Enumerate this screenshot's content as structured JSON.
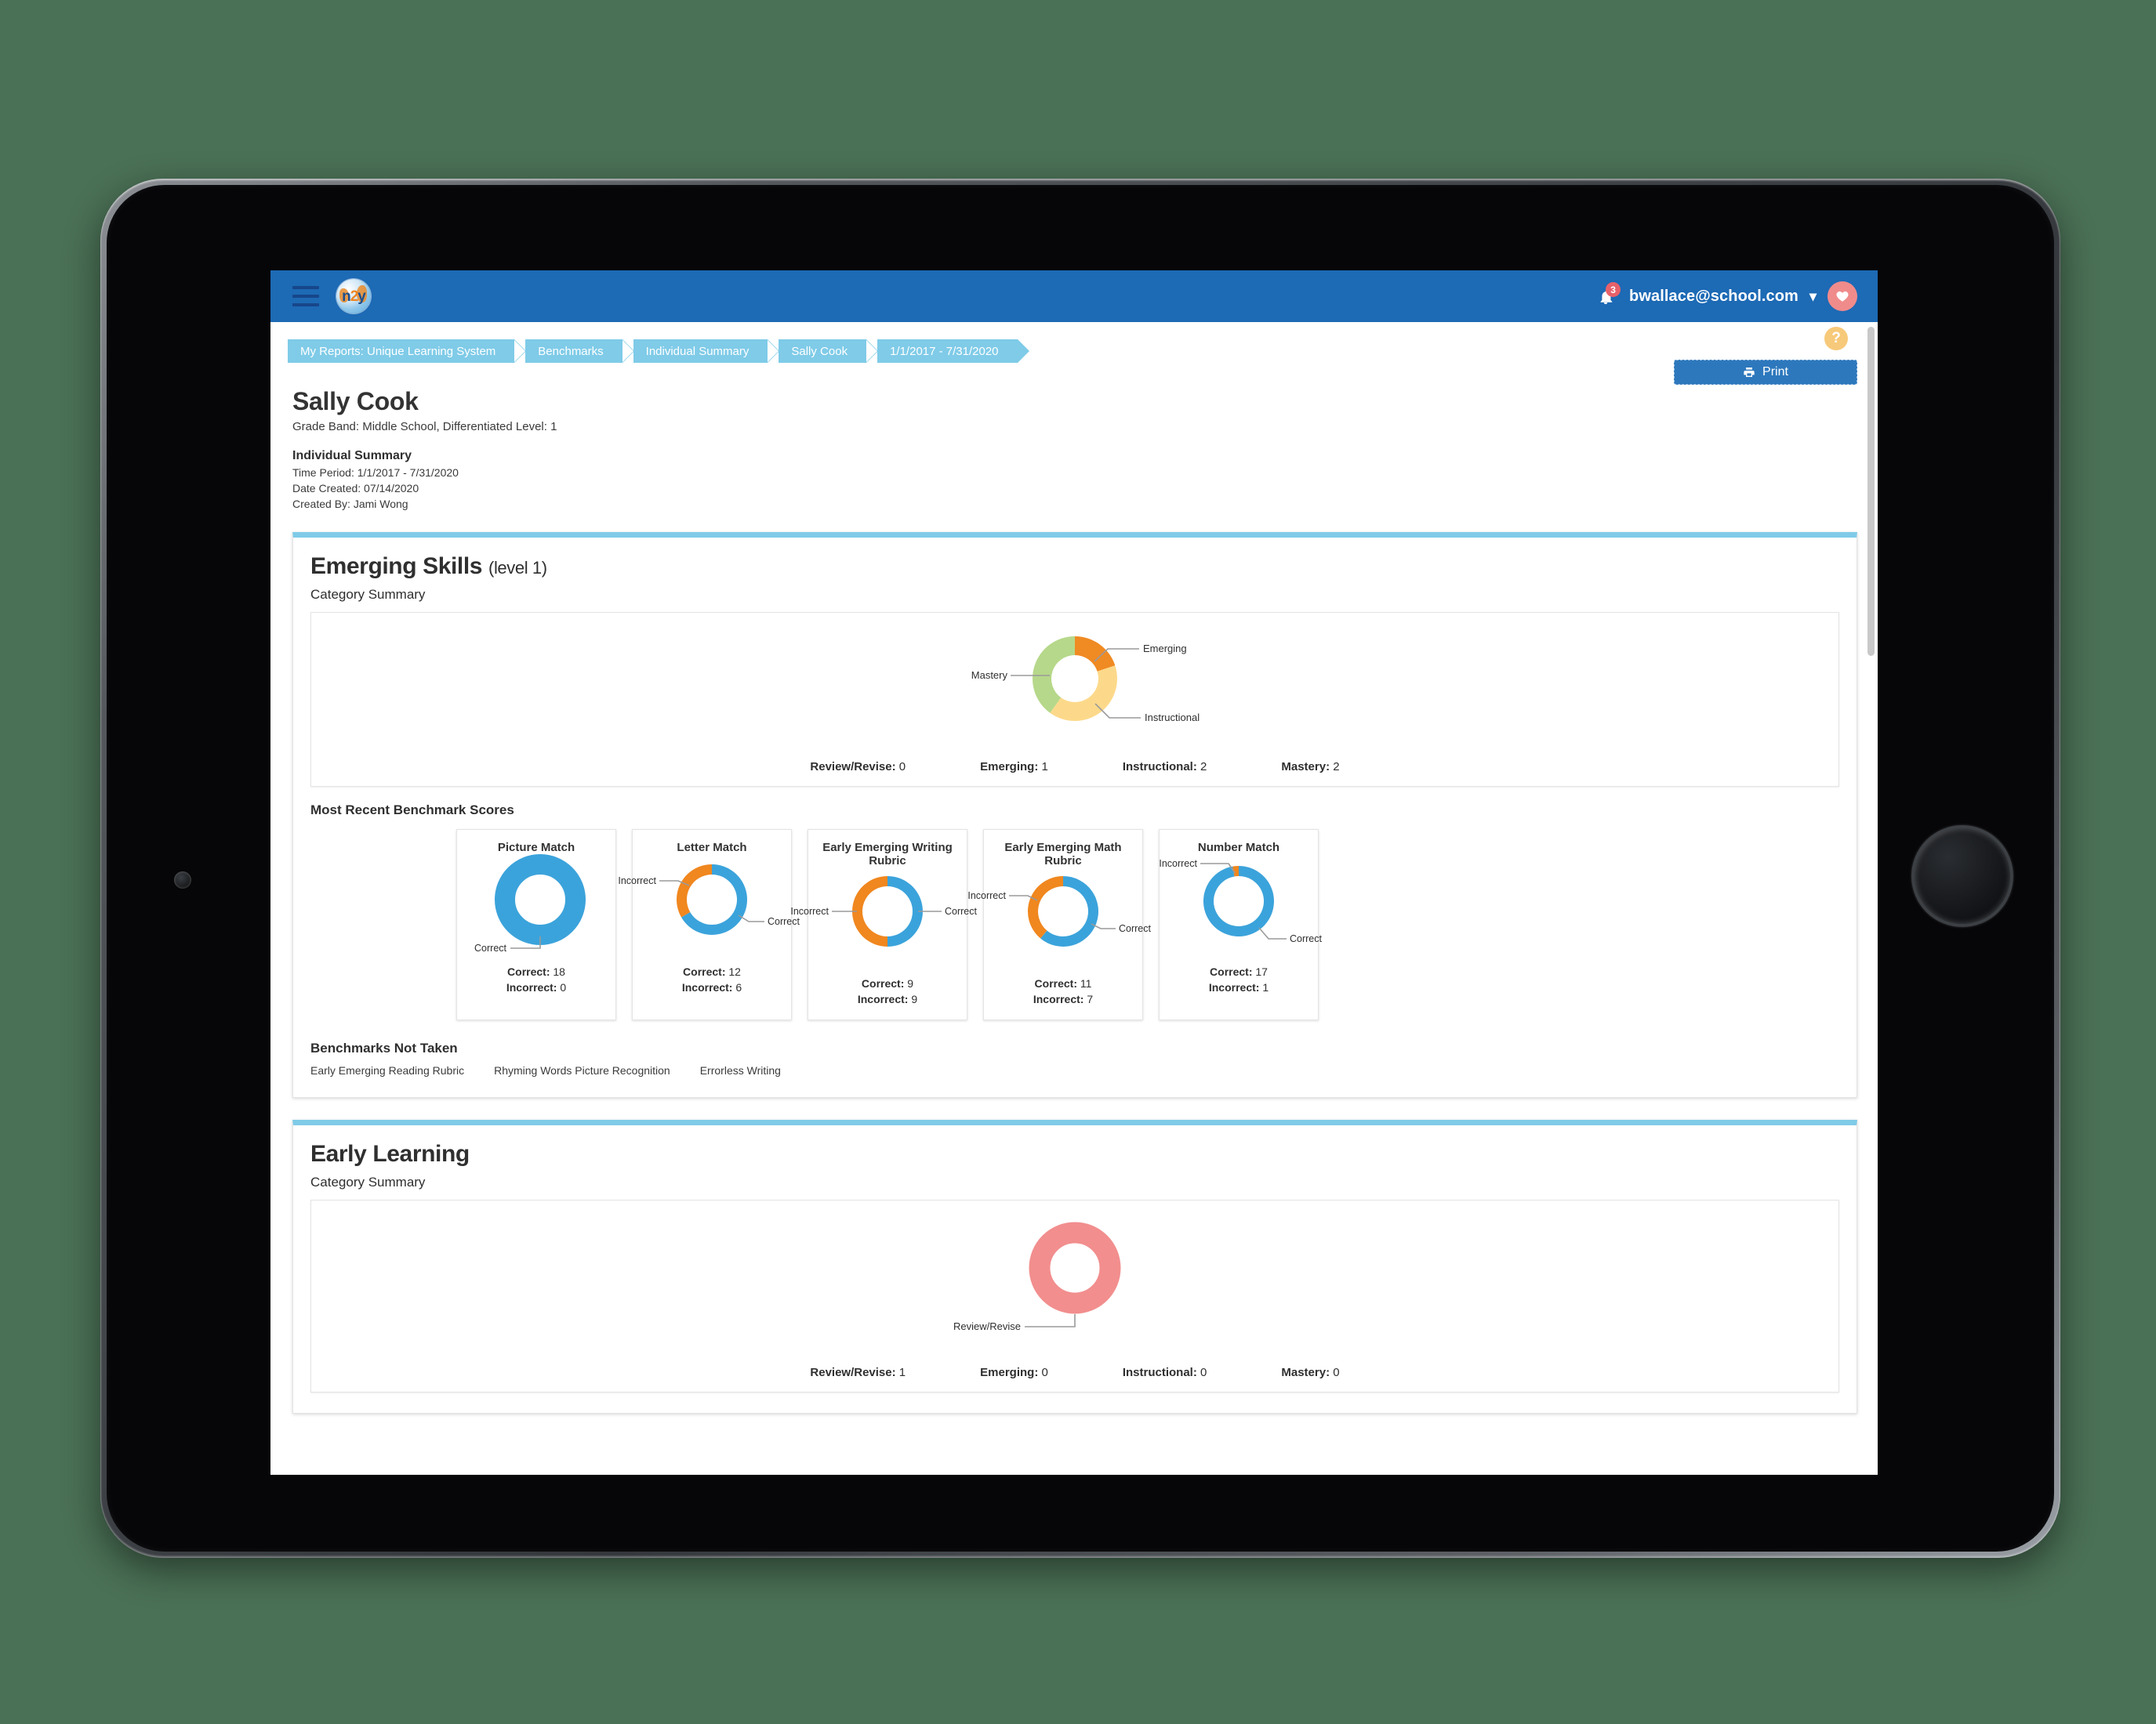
{
  "app": {
    "logo_text_left": "n",
    "logo_text_mid": "2",
    "logo_text_right": "y",
    "user_email": "bwallace@school.com",
    "notification_count": "3",
    "menu_icon": "hamburger-icon",
    "caret": "▾",
    "bell_glyph": "🔔",
    "avatar_glyph": "♥"
  },
  "breadcrumb": {
    "items": [
      "My Reports: Unique Learning System",
      "Benchmarks",
      "Individual Summary",
      "Sally Cook",
      "1/1/2017 - 7/31/2020"
    ]
  },
  "toolbar": {
    "help_label": "?",
    "print_label": "Print",
    "print_icon": "⎙"
  },
  "student": {
    "name": "Sally Cook",
    "grade_line": "Grade Band: Middle School, Differentiated Level: 1",
    "report_type": "Individual Summary",
    "time_period": "Time Period: 1/1/2017 - 7/31/2020",
    "date_created": "Date Created: 07/14/2020",
    "created_by": "Created By: Jami Wong"
  },
  "colors": {
    "brand_blue": "#1d6ab5",
    "accent_light_blue": "#7fcbe8",
    "correct_blue": "#3ba3db",
    "incorrect_orange": "#f0871f",
    "review_revise": "#f28e8e",
    "emerging": "#f08a23",
    "instructional": "#fcd98a",
    "mastery": "#b6d88a"
  },
  "sections": [
    {
      "title": "Emerging Skills",
      "title_suffix": "(level 1)",
      "summary_label": "Category Summary",
      "scores_label": "Most Recent Benchmark Scores",
      "not_taken_label": "Benchmarks Not Taken",
      "not_taken": [
        "Early Emerging Reading Rubric",
        "Rhyming Words Picture Recognition",
        "Errorless Writing"
      ],
      "legend": [
        {
          "label": "Review/Revise:",
          "value": "0"
        },
        {
          "label": "Emerging:",
          "value": "1"
        },
        {
          "label": "Instructional:",
          "value": "2"
        },
        {
          "label": "Mastery:",
          "value": "2"
        }
      ]
    },
    {
      "title": "Early Learning",
      "title_suffix": "",
      "summary_label": "Category Summary",
      "legend": [
        {
          "label": "Review/Revise:",
          "value": "1"
        },
        {
          "label": "Emerging:",
          "value": "0"
        },
        {
          "label": "Instructional:",
          "value": "0"
        },
        {
          "label": "Mastery:",
          "value": "0"
        }
      ]
    }
  ],
  "labels": {
    "correct": "Correct",
    "incorrect": "Incorrect",
    "correct_prefix": "Correct:",
    "incorrect_prefix": "Incorrect:",
    "emerging": "Emerging",
    "instructional": "Instructional",
    "mastery": "Mastery",
    "review_revise": "Review/Revise"
  },
  "chart_data": [
    {
      "type": "pie",
      "id": "emerging-skills-category-summary",
      "title": "Emerging Skills Category Summary",
      "donut": true,
      "categories": [
        "Review/Revise",
        "Emerging",
        "Instructional",
        "Mastery"
      ],
      "values": [
        0,
        1,
        2,
        2
      ],
      "colors": [
        "#f28e8e",
        "#f08a23",
        "#fcd98a",
        "#b6d88a"
      ],
      "annotations": [
        "Emerging",
        "Instructional",
        "Mastery"
      ],
      "legend_position": "bottom"
    },
    {
      "type": "pie",
      "id": "picture-match",
      "title": "Picture Match",
      "donut": true,
      "categories": [
        "Correct",
        "Incorrect"
      ],
      "values": [
        18,
        0
      ],
      "colors": [
        "#3ba3db",
        "#f0871f"
      ],
      "annotations": [
        "Correct"
      ],
      "legend_position": "bottom"
    },
    {
      "type": "pie",
      "id": "letter-match",
      "title": "Letter Match",
      "donut": true,
      "categories": [
        "Correct",
        "Incorrect"
      ],
      "values": [
        12,
        6
      ],
      "colors": [
        "#3ba3db",
        "#f0871f"
      ],
      "annotations": [
        "Correct",
        "Incorrect"
      ],
      "legend_position": "bottom"
    },
    {
      "type": "pie",
      "id": "early-emerging-writing-rubric",
      "title": "Early Emerging Writing Rubric",
      "donut": true,
      "categories": [
        "Correct",
        "Incorrect"
      ],
      "values": [
        9,
        9
      ],
      "colors": [
        "#3ba3db",
        "#f0871f"
      ],
      "annotations": [
        "Correct",
        "Incorrect"
      ],
      "legend_position": "bottom"
    },
    {
      "type": "pie",
      "id": "early-emerging-math-rubric",
      "title": "Early Emerging Math Rubric",
      "donut": true,
      "categories": [
        "Correct",
        "Incorrect"
      ],
      "values": [
        11,
        7
      ],
      "colors": [
        "#3ba3db",
        "#f0871f"
      ],
      "annotations": [
        "Correct",
        "Incorrect"
      ],
      "legend_position": "bottom"
    },
    {
      "type": "pie",
      "id": "number-match",
      "title": "Number Match",
      "donut": true,
      "categories": [
        "Correct",
        "Incorrect"
      ],
      "values": [
        17,
        1
      ],
      "colors": [
        "#3ba3db",
        "#f0871f"
      ],
      "annotations": [
        "Correct",
        "Incorrect"
      ],
      "legend_position": "bottom"
    },
    {
      "type": "pie",
      "id": "early-learning-category-summary",
      "title": "Early Learning Category Summary",
      "donut": true,
      "categories": [
        "Review/Revise",
        "Emerging",
        "Instructional",
        "Mastery"
      ],
      "values": [
        1,
        0,
        0,
        0
      ],
      "colors": [
        "#f28e8e",
        "#f08a23",
        "#fcd98a",
        "#b6d88a"
      ],
      "annotations": [
        "Review/Revise"
      ],
      "legend_position": "bottom"
    }
  ],
  "benchmark_cards": [
    {
      "title": "Picture Match",
      "correct": "18",
      "incorrect": "0"
    },
    {
      "title": "Letter Match",
      "correct": "12",
      "incorrect": "6"
    },
    {
      "title": "Early Emerging Writing Rubric",
      "correct": "9",
      "incorrect": "9"
    },
    {
      "title": "Early Emerging Math Rubric",
      "correct": "11",
      "incorrect": "7"
    },
    {
      "title": "Number Match",
      "correct": "17",
      "incorrect": "1"
    }
  ]
}
